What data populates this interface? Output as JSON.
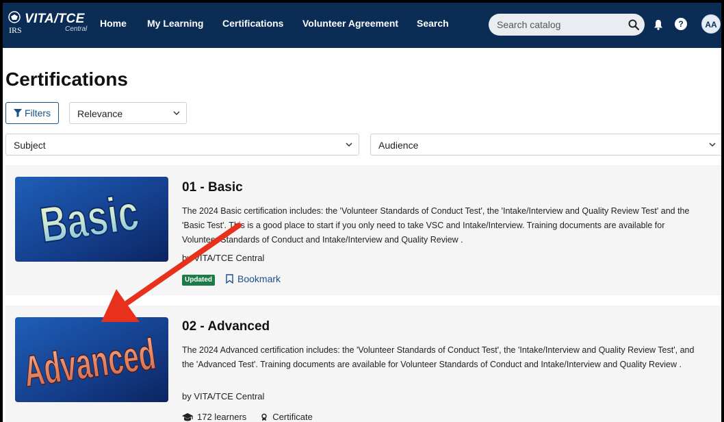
{
  "header": {
    "logo_brand": "VITA/TCE",
    "logo_sub": "Central",
    "logo_agency": "IRS",
    "nav": [
      "Home",
      "My Learning",
      "Certifications",
      "Volunteer Agreement",
      "Search"
    ],
    "search_placeholder": "Search catalog",
    "avatar_initials": "AA",
    "help_glyph": "?"
  },
  "page": {
    "title": "Certifications",
    "filters_label": "Filters",
    "sort_value": "Relevance",
    "subject_value": "Subject",
    "audience_value": "Audience"
  },
  "courses": [
    {
      "title": "01 - Basic",
      "thumb_text": "Basic",
      "description": "The 2024 Basic certification includes: the 'Volunteer Standards of Conduct Test', the 'Intake/Interview and Quality Review Test' and the 'Basic Test'. This is a good place to start if you only need to take VSC and Intake/Interview. Training documents are available for Volunteer Standards of Conduct and Intake/Interview and Quality Review .",
      "byline": "by VITA/TCE Central",
      "badge": "Updated",
      "bookmark_label": "Bookmark"
    },
    {
      "title": "02 - Advanced",
      "thumb_text": "Advanced",
      "description": "The 2024 Advanced certification includes: the 'Volunteer Standards of Conduct Test', the 'Intake/Interview and Quality Review Test', and the 'Advanced Test'. Training documents are available for Volunteer Standards of Conduct and Intake/Interview and Quality Review .",
      "byline": "by VITA/TCE Central",
      "learners": "172 learners",
      "certificate": "Certificate"
    }
  ],
  "colors": {
    "nav_bg": "#0b2d55",
    "link": "#1a4f8b",
    "badge": "#1b7d45",
    "annotation_arrow": "#e8311c"
  }
}
